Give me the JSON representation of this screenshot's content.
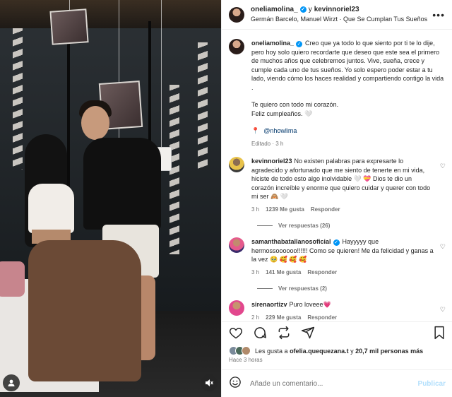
{
  "post": {
    "author": "oneliamolina_",
    "conjunction": "y",
    "coauthor": "kevinnoriel23",
    "audio": "Germán Barcelo, Manuel Wirzt · Que Se Cumplan Tus Sueños"
  },
  "caption": {
    "username": "oneliamolina_",
    "text": "Creo que ya todo lo que siento por ti te lo dije, pero hoy solo quiero recordarte que deseo que este sea el primero de muchos años que celebremos juntos. Vive, sueña, crece y cumple cada uno de tus sueños. Yo solo espero poder estar a tu lado, viendo cómo los haces realidad y compartiendo contigo la vida .",
    "text2": "Te quiero con todo mi corazón.\nFeliz cumpleaños. 🤍",
    "location": "@nhowlima",
    "edited": "Editado · 3 h"
  },
  "comments": [
    {
      "username": "kevinnoriel23",
      "text": "No existen palabras para expresarte lo agradecido y afortunado que me siento de tenerte en mi vida, hiciste de todo esto algo inolvidable 🤍 💝 Dios te dio un corazón increíble y enorme que quiero cuidar y querer con todo mi ser 🙈 🤍",
      "time": "3 h",
      "likes": "1239 Me gusta",
      "reply": "Responder",
      "replies": "Ver respuestas (26)"
    },
    {
      "username": "samanthabatallanosoficial",
      "text": "Hayyyyy que hermossoooooo!!!!!! Como se quieren! Me da felicidad y ganas a la vez 🥹 🥰 🥰 🥰",
      "time": "3 h",
      "likes": "141 Me gusta",
      "reply": "Responder",
      "replies": "Ver respuestas (2)"
    },
    {
      "username": "sirenaortizv",
      "text": "Puro loveee💗",
      "time": "2 h",
      "likes": "229 Me gusta",
      "reply": "Responder"
    }
  ],
  "likes": {
    "prefix": "Les gusta a",
    "user": "ofelia.quequezana.t",
    "middle": "y",
    "others": "20,7 mil personas más"
  },
  "posted_ago": "Hace 3 horas",
  "add_comment": {
    "placeholder": "Añade un comentario...",
    "publish": "Publicar"
  },
  "icons": {
    "heart": "heart-icon",
    "comment": "comment-icon",
    "repost": "repost-icon",
    "share": "share-icon",
    "bookmark": "bookmark-icon",
    "mute": "mute-icon",
    "tagged": "user-tag-icon",
    "more": "more-icon",
    "emoji": "smile-icon"
  },
  "colors": {
    "link": "#00376b",
    "verified": "#0095f6",
    "publish_disabled": "#b2dffc",
    "muted_text": "#737373"
  }
}
